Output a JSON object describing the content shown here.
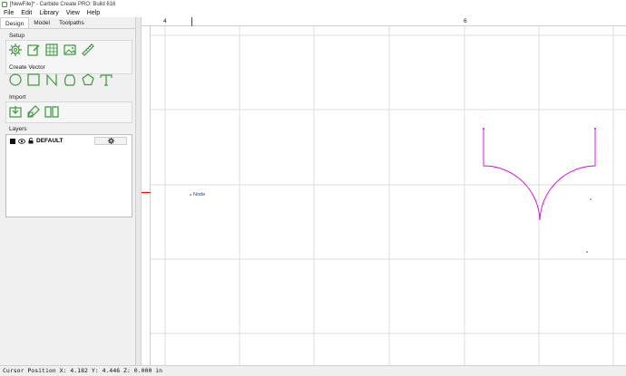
{
  "window": {
    "title": "[NewFile]* - Carbide Create PRO: Build 616"
  },
  "menu": {
    "items": [
      "File",
      "Edit",
      "Library",
      "View",
      "Help"
    ]
  },
  "sidebar": {
    "tabs": [
      {
        "label": "Design",
        "active": true
      },
      {
        "label": "Model",
        "active": false
      },
      {
        "label": "Toolpaths",
        "active": false
      }
    ],
    "sections": {
      "setup": "Setup",
      "create_vector": "Create Vector",
      "import": "Import",
      "layers": "Layers"
    },
    "setup_icons": [
      "gear-icon",
      "edit-icon",
      "grid-icon",
      "image-icon",
      "ruler-icon"
    ],
    "vector_icons": [
      "circle-icon",
      "rectangle-icon",
      "curve-icon",
      "polygon-icon",
      "pentagon-icon",
      "text-icon"
    ],
    "import_icons": [
      "import-icon",
      "edit-import-icon",
      "library-icon"
    ],
    "layer": {
      "name": "DEFAULT",
      "color": "#111111"
    }
  },
  "canvas": {
    "ruler_labels": [
      "4",
      "6"
    ],
    "node_label": "Node",
    "accent_color": "#e000e0",
    "cursor_marker_color": "#ff0000"
  },
  "status": {
    "cursor": "Cursor Position X: 4.182 Y: 4.446 Z: 0.000 in"
  },
  "theme": {
    "icon_color": "#3a9a3a"
  }
}
